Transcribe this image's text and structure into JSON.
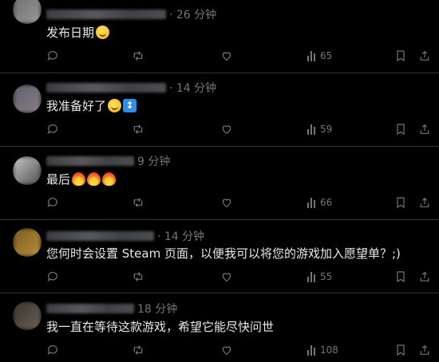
{
  "replies": [
    {
      "time": "· 26 分钟",
      "text": "发布日期",
      "emojis": [
        "smile"
      ],
      "views": "65",
      "avatar_colors": [
        "#6e6e6e",
        "#9a9a9a"
      ]
    },
    {
      "time": "· 14 分钟",
      "text": "我准备好了",
      "emojis": [
        "smile",
        "updown"
      ],
      "views": "59",
      "avatar_colors": [
        "#58606e",
        "#8d7f86"
      ]
    },
    {
      "time": "9 分钟",
      "text": "最后",
      "emojis": [
        "fire",
        "fire",
        "fire"
      ],
      "views": "66",
      "avatar_colors": [
        "#c9c9c9",
        "#4d4d4d"
      ]
    },
    {
      "time": "· 14 分钟",
      "text": "您何时会设置 Steam 页面，以便我可以将您的游戏加入愿望单？;)",
      "emojis": [],
      "views": "55",
      "avatar_colors": [
        "#7a5a1e",
        "#b9903a"
      ]
    },
    {
      "time": "18 分钟",
      "text": "我一直在等待这款游戏，希望它能尽快问世",
      "emojis": [],
      "views": "108",
      "avatar_colors": [
        "#3a3530",
        "#6a5f55"
      ]
    }
  ],
  "icons": {
    "reply": "reply-icon",
    "repost": "repost-icon",
    "like": "heart-icon",
    "views": "views-icon",
    "bookmark": "bookmark-icon",
    "share": "share-icon"
  }
}
